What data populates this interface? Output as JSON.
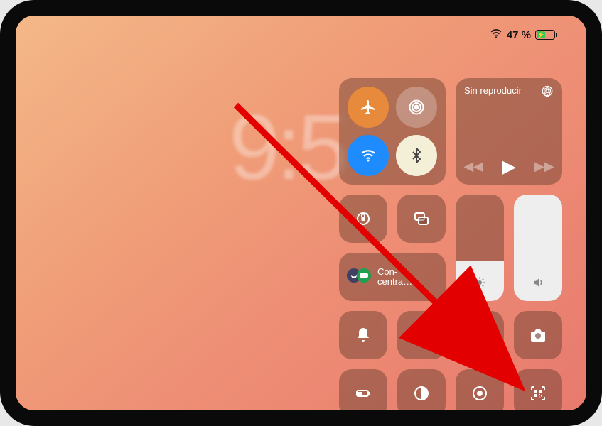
{
  "status": {
    "battery_pct": "47 %"
  },
  "clock": {
    "time": "9:5"
  },
  "media": {
    "now_playing_label": "Sin reproducir"
  },
  "focus": {
    "label": "Con-\ncentra…"
  },
  "sliders": {
    "brightness_fill_pct": 38,
    "volume_fill_pct": 100
  }
}
